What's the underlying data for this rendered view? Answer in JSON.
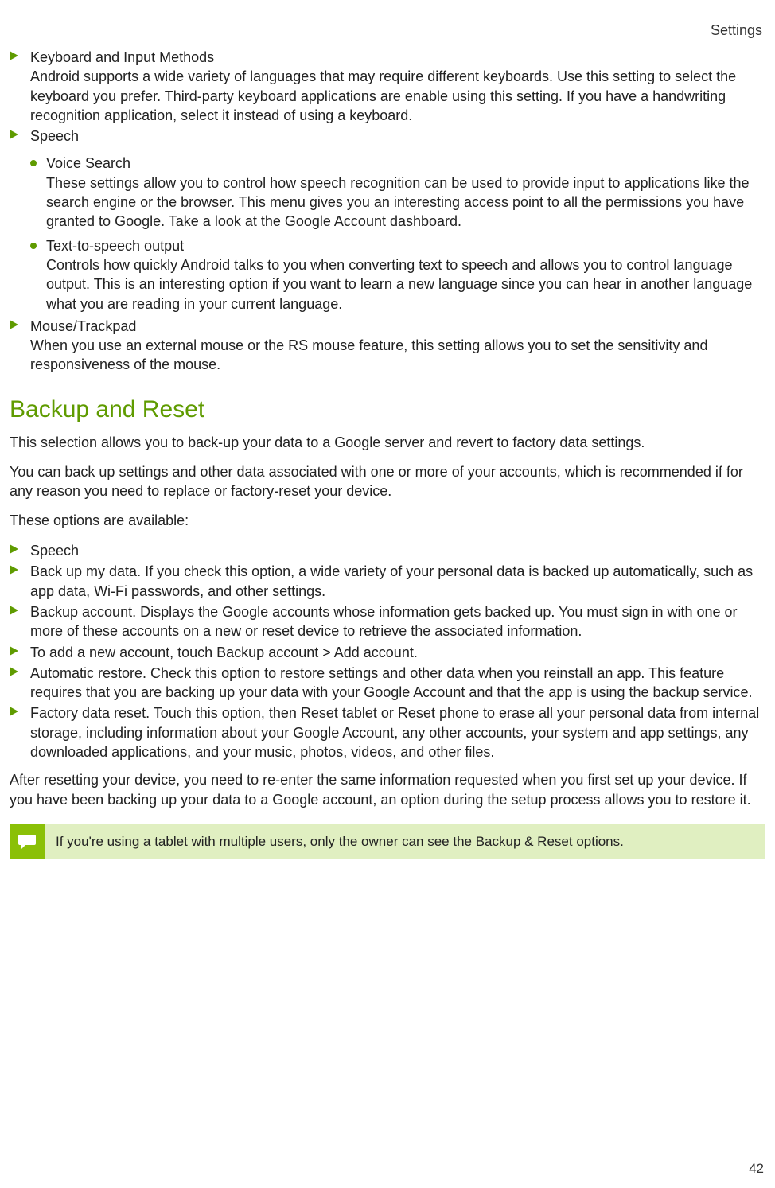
{
  "header": {
    "title": "Settings"
  },
  "pageNumber": "42",
  "topList": [
    {
      "title": "Keyboard and Input Methods",
      "body": "Android supports a wide variety of languages that may require different keyboards. Use this setting to select the keyboard you prefer. Third-party keyboard applications are enable using this setting. If you have a handwriting recognition application, select it instead of using a keyboard."
    },
    {
      "title": "Speech",
      "body": "",
      "sub": [
        {
          "title": "Voice Search",
          "body": "These settings allow you to control how speech recognition can be used to provide input to applications like the search engine or the browser. This menu gives you an interesting access point to all the permissions you have granted to Google. Take a look at the Google Account dashboard."
        },
        {
          "title": "Text-to-speech output",
          "body": "Controls how quickly Android talks to you when converting text to speech and allows you to control language output. This is an interesting option if you want to learn a new language since you can hear in another language what you are reading in your current language."
        }
      ]
    },
    {
      "title": "Mouse/Trackpad",
      "body": "When you use an external mouse or the RS mouse feature, this setting allows you to set the sensitivity and responsiveness of the mouse."
    }
  ],
  "section": {
    "heading": "Backup and Reset",
    "p1": "This selection allows you to back-up your data to a Google server and revert to factory data settings.",
    "p2": "You can back up settings and other data associated with one or more of your accounts, which is recommended if for any reason you need to replace or factory-reset your device.",
    "p3": "These options are available:",
    "list": [
      "Speech",
      "Back up my data. If you check this option, a wide variety of your personal data is backed up automatically, such as app data, Wi-Fi passwords, and other settings.",
      "Backup account. Displays the Google accounts whose information gets backed up. You must sign in with one or more of these accounts on a new or reset device to retrieve the associated information.",
      "To add a new account, touch Backup account > Add account.",
      "Automatic restore. Check this option to restore settings and other data when you reinstall an app. This feature requires that you are backing up your data with your Google Account and that the app is using the backup service.",
      "Factory data reset. Touch this option, then Reset tablet or Reset phone to erase all your personal data from internal storage, including information about your Google Account, any other accounts, your system and app settings, any downloaded applications, and your music, photos, videos, and other files."
    ],
    "p4": "After resetting your device, you need to re-enter the same information requested when you first set up your device. If you have been backing up your data to a Google account, an option during the setup process allows you to restore it."
  },
  "note": "If you're using a tablet with multiple users, only the owner can see the Backup & Reset options."
}
